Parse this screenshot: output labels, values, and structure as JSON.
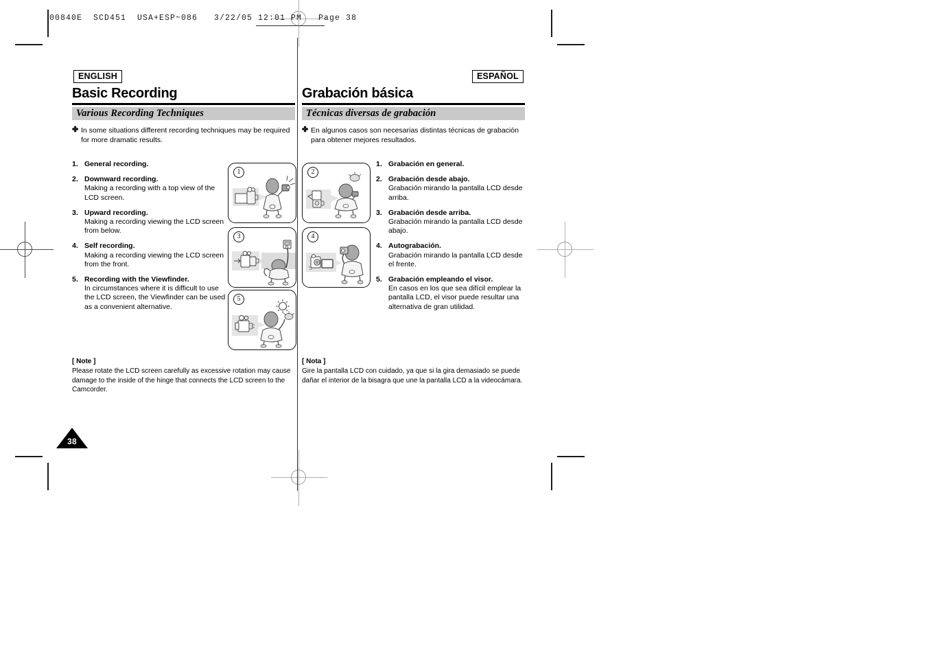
{
  "prepress": {
    "slug": "00840E  SCD451  USA+ESP~086   3/22/05 12:01 PM   Page 38"
  },
  "left_column": {
    "lang_tag": "ENGLISH",
    "title": "Basic Recording",
    "section_heading": "Various Recording Techniques",
    "intro": "In some situations different recording techniques may be required for more dramatic results.",
    "bullet_glyph": "✤",
    "items": [
      {
        "num": "1.",
        "head": "General recording.",
        "body": ""
      },
      {
        "num": "2.",
        "head": "Downward recording.",
        "body": "Making a recording with a top view of the LCD screen."
      },
      {
        "num": "3.",
        "head": "Upward recording.",
        "body": "Making a recording viewing the LCD screen from below."
      },
      {
        "num": "4.",
        "head": "Self recording.",
        "body": "Making a recording viewing the LCD screen from the front."
      },
      {
        "num": "5.",
        "head": "Recording with the Viewfinder.",
        "body": "In circumstances where it is difficult to use the LCD screen, the Viewfinder can be used as a convenient alternative."
      }
    ],
    "note_label": "[ Note ]",
    "note_body": "Please rotate the LCD screen carefully as excessive rotation may cause damage to the inside of the hinge that connects the LCD screen to the Camcorder.",
    "page_number": "38"
  },
  "right_column": {
    "lang_tag": "ESPAÑOL",
    "title": "Grabación básica",
    "section_heading": "Técnicas diversas de grabación",
    "intro": "En algunos casos son necesarias distintas técnicas de grabación para obtener mejores resultados.",
    "bullet_glyph": "✤",
    "items": [
      {
        "num": "1.",
        "head": "Grabación en general.",
        "body": ""
      },
      {
        "num": "2.",
        "head": "Grabación desde abajo.",
        "body": "Grabación mirando la pantalla LCD desde arriba."
      },
      {
        "num": "3.",
        "head": "Grabación desde arriba.",
        "body": "Grabación mirando la pantalla LCD desde abajo."
      },
      {
        "num": "4.",
        "head": "Autograbación.",
        "body": "Grabación mirando la pantalla LCD desde el frente."
      },
      {
        "num": "5.",
        "head": "Grabación empleando el visor.",
        "body": "En casos en los que sea difícil emplear la pantalla LCD, el visor puede resultar una alternativa de gran utilidad."
      }
    ],
    "note_label": "[ Nota ]",
    "note_body": "Gire la pantalla LCD con cuidado, ya que si la gira demasiado se puede dañar el interior de la bisagra que une la pantalla LCD a la videocámara."
  },
  "illustrations": [
    {
      "badge": "1",
      "caption": "general-recording-person-holding-camcorder"
    },
    {
      "badge": "2",
      "caption": "downward-recording-top-view-of-lcd"
    },
    {
      "badge": "3",
      "caption": "upward-recording-low-angle-lcd"
    },
    {
      "badge": "4",
      "caption": "self-recording-lcd-facing-front"
    },
    {
      "badge": "5",
      "caption": "recording-with-viewfinder-outdoors"
    }
  ],
  "colors": {
    "section_bar": "#c9c9c9",
    "rule": "#000000",
    "illustration_panel": "#e4e4e4"
  }
}
